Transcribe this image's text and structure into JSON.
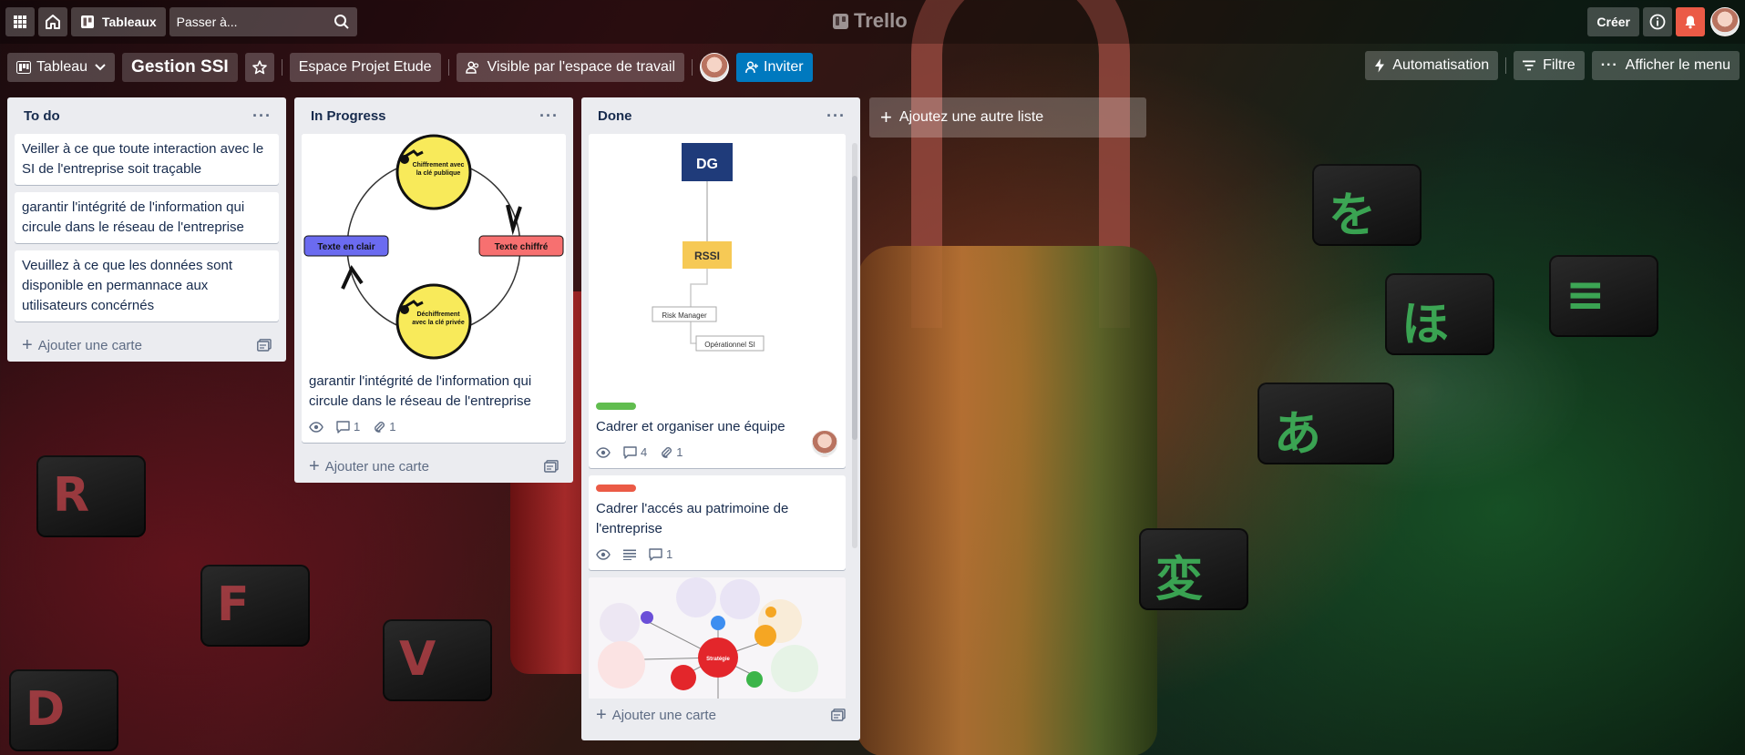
{
  "app": {
    "logo_text": "Trello"
  },
  "topbar": {
    "boards_label": "Tableaux",
    "search_placeholder": "Passer à...",
    "create_label": "Créer"
  },
  "board": {
    "view_label": "Tableau",
    "title": "Gestion SSI",
    "workspace_label": "Espace Projet Etude",
    "visibility_label": "Visible par l'espace de travail",
    "invite_label": "Inviter",
    "automation_label": "Automatisation",
    "filter_label": "Filtre",
    "menu_label": "Afficher le menu"
  },
  "lists": [
    {
      "title": "To do",
      "cards": [
        "Veiller à ce que toute interaction avec le SI de l'entreprise soit traçable",
        "garantir l'intégrité de l'information qui circule dans le réseau de l'entreprise",
        "Veuillez à ce que les données sont disponible en permannace aux utilisateurs concérnés"
      ],
      "add_card_label": "Ajouter une carte"
    },
    {
      "title": "In Progress",
      "cards": [
        {
          "cover": {
            "top": "Chiffrement avec la clé publique",
            "bottom": "Déchiffrement avec la clé privée",
            "left": "Texte en clair",
            "right": "Texte chiffré"
          },
          "title": "garantir l'intégrité de l'information qui circule dans le réseau de l'entreprise",
          "comments": "1",
          "attachments": "1"
        }
      ],
      "add_card_label": "Ajouter une carte"
    },
    {
      "title": "Done",
      "cards": [
        {
          "cover": {
            "dg": "DG",
            "rssi": "RSSI",
            "risk": "Risk Manager",
            "ops": "Opérationnel SI"
          },
          "label_color": "#61bd4f",
          "title": "Cadrer et organiser une équipe",
          "comments": "4",
          "attachments": "1"
        },
        {
          "label_color": "#eb5a46",
          "title": "Cadrer l'accés au patrimoine de l'entreprise",
          "comments": "1"
        },
        {
          "cover": {
            "center": "Stratégie"
          }
        }
      ],
      "add_card_label": "Ajouter une carte"
    }
  ],
  "add_list_label": "Ajoutez une autre liste",
  "colors": {
    "invite_blue": "#0079bf",
    "notification_red": "#eb5a46",
    "list_bg": "#ebecf0",
    "label_green": "#61bd4f",
    "label_red": "#eb5a46"
  }
}
